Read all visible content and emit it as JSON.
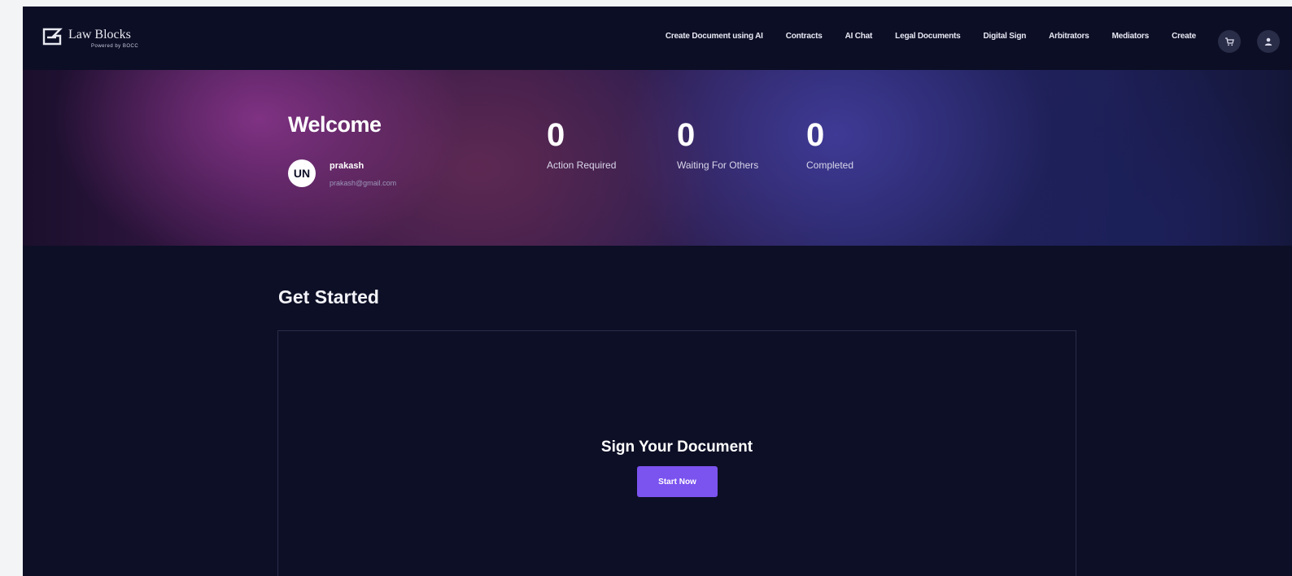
{
  "navbar": {
    "logo_text": "Law Blocks",
    "logo_sub": "Powered by BOCC",
    "links": [
      "Create Document using AI",
      "Contracts",
      "AI Chat",
      "Legal Documents",
      "Digital Sign",
      "Arbitrators",
      "Mediators",
      "Create"
    ],
    "cart_icon": "cart-icon",
    "user_icon": "user-icon"
  },
  "hero": {
    "welcome": "Welcome",
    "avatar_initials": "UN",
    "user_name": "prakash",
    "user_email": "prakash@gmail.com",
    "stats": [
      {
        "value": "0",
        "label": "Action Required"
      },
      {
        "value": "0",
        "label": "Waiting For Others"
      },
      {
        "value": "0",
        "label": "Completed"
      }
    ]
  },
  "get_started": {
    "title": "Get Started",
    "card_title": "Sign Your Document",
    "button_label": "Start Now"
  },
  "colors": {
    "background": "#0d0f26",
    "accent": "#7b53ef"
  }
}
